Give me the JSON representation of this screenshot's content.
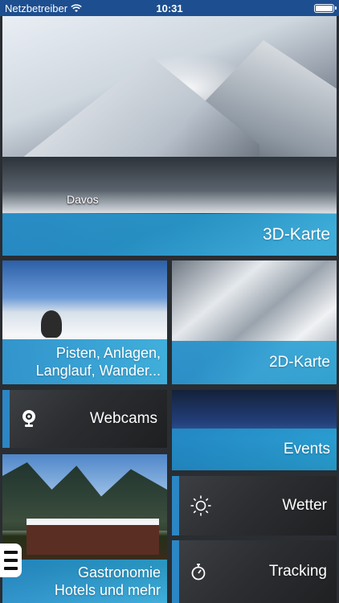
{
  "status_bar": {
    "carrier": "Netzbetreiber",
    "time": "10:31"
  },
  "hero": {
    "label": "3D-Karte",
    "place_label": "Davos"
  },
  "tiles": {
    "pisten": {
      "label_line1": "Pisten, Anlagen,",
      "label_line2": "Langlauf, Wander..."
    },
    "karte2d": {
      "label": "2D-Karte"
    },
    "webcams": {
      "label": "Webcams",
      "icon": "webcam-icon"
    },
    "events": {
      "label": "Events"
    },
    "gastro": {
      "label_line1": "Gastronomie",
      "label_line2": "Hotels und mehr"
    },
    "wetter": {
      "label": "Wetter",
      "icon": "sun-icon"
    },
    "tracking": {
      "label": "Tracking",
      "icon": "stopwatch-icon"
    }
  },
  "colors": {
    "status_bar": "#1d4e8f",
    "accent_blue": "#2c86c4",
    "background": "#2a2d31"
  }
}
